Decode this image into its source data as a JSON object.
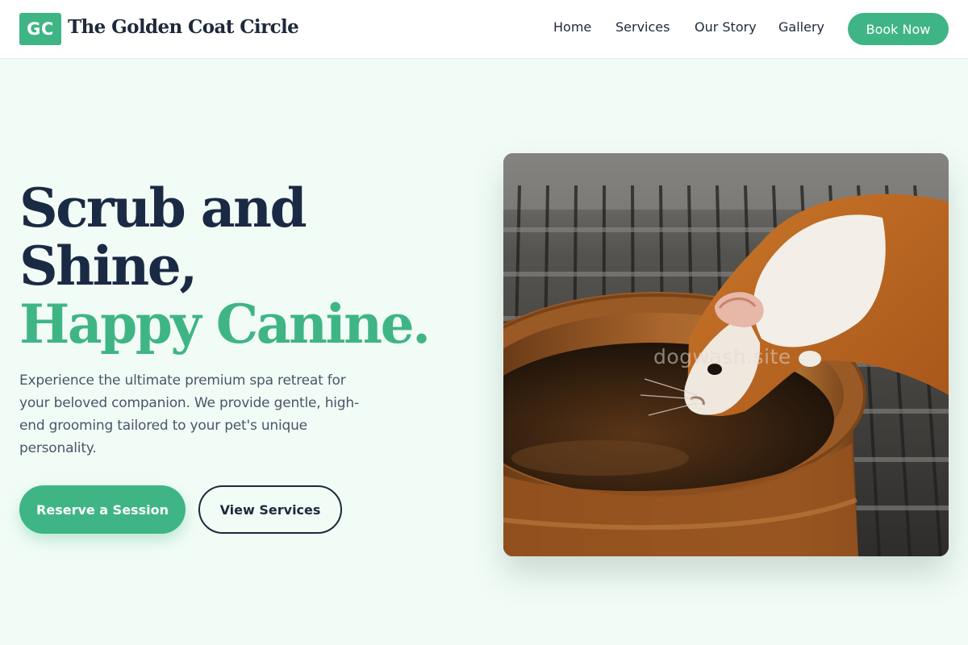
{
  "header": {
    "logo_initials": "GC",
    "brand_name": "The Golden Coat Circle",
    "nav": [
      "Home",
      "Services",
      "Our Story",
      "Gallery"
    ],
    "cta_label": "Book Now"
  },
  "hero": {
    "title_line1": "Scrub and",
    "title_line2": "Shine,",
    "title_accent": "Happy Canine.",
    "description": "Experience the ultimate premium spa retreat for your beloved companion. We provide gentle, high-end grooming tailored to your pet's unique personality.",
    "primary_button": "Reserve a Session",
    "secondary_button": "View Services",
    "image_watermark": "dogwash.site"
  },
  "colors": {
    "accent": "#3fb585",
    "heading": "#1b2a44",
    "page_background": "#f2fcf7"
  }
}
